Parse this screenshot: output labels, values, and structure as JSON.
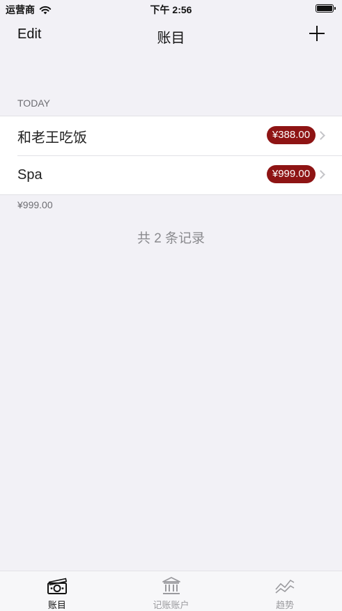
{
  "status_bar": {
    "carrier": "运营商",
    "time": "下午 2:56"
  },
  "nav": {
    "edit_label": "Edit",
    "title": "账目",
    "add_icon": "plus-icon"
  },
  "section": {
    "header": "TODAY",
    "rows": [
      {
        "name": "和老王吃饭",
        "amount": "¥388.00"
      },
      {
        "name": "Spa",
        "amount": "¥999.00"
      }
    ],
    "footer": "¥999.00"
  },
  "record_count": "共 2 条记录",
  "tabs": [
    {
      "label": "账目",
      "icon": "money-stack-icon",
      "active": true
    },
    {
      "label": "记账账户",
      "icon": "bank-icon",
      "active": false
    },
    {
      "label": "趋势",
      "icon": "trend-icon",
      "active": false
    }
  ],
  "colors": {
    "accent": "#8e1414",
    "background": "#f2f1f6"
  }
}
